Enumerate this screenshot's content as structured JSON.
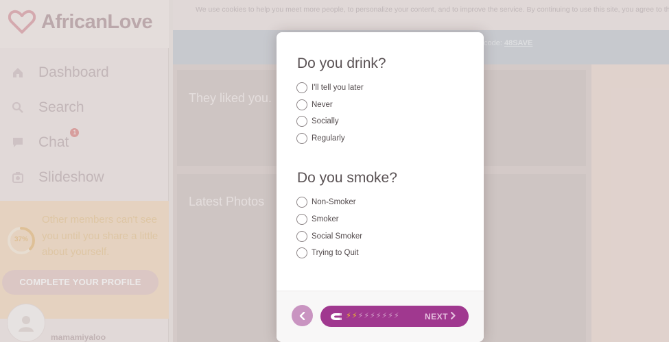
{
  "app": {
    "logo_text": "AfricanLove"
  },
  "sidebar": {
    "items": [
      {
        "label": "Dashboard",
        "icon": "home-icon"
      },
      {
        "label": "Search",
        "icon": "search-icon"
      },
      {
        "label": "Chat",
        "icon": "chat-icon",
        "badge": "1"
      },
      {
        "label": "Slideshow",
        "icon": "slideshow-icon"
      }
    ],
    "promo": {
      "progress_text": "37%",
      "progress_value": 0.37,
      "message": "Other members can't see you until you share a little about yourself.",
      "button_label": "COMPLETE YOUR PROFILE"
    },
    "user": {
      "name": "mamamiyaloo"
    }
  },
  "topbar": {
    "cookie_text": "We use cookies to help you meet more people, to personalize your content, and to improve the service. By continuing to use this site, you agree to the",
    "promo_code_prefix": "code:",
    "promo_code": "48SAVE"
  },
  "main": {
    "cards": [
      {
        "title": "They liked you."
      },
      {
        "title": "Latest Photos"
      }
    ]
  },
  "modal": {
    "drink": {
      "question": "Do you drink?",
      "options": [
        "I'll tell you later",
        "Never",
        "Socially",
        "Regularly"
      ]
    },
    "smoke": {
      "question": "Do you smoke?",
      "options": [
        "Non-Smoker",
        "Smoker",
        "Social Smoker",
        "Trying to Quit"
      ]
    },
    "footer": {
      "next_label": "NEXT",
      "bolts_total": 9,
      "bolts_filled": 2
    }
  },
  "colors": {
    "accent": "#a0388f",
    "back_button": "#c994c1",
    "bolt_on": "#f3c623"
  }
}
